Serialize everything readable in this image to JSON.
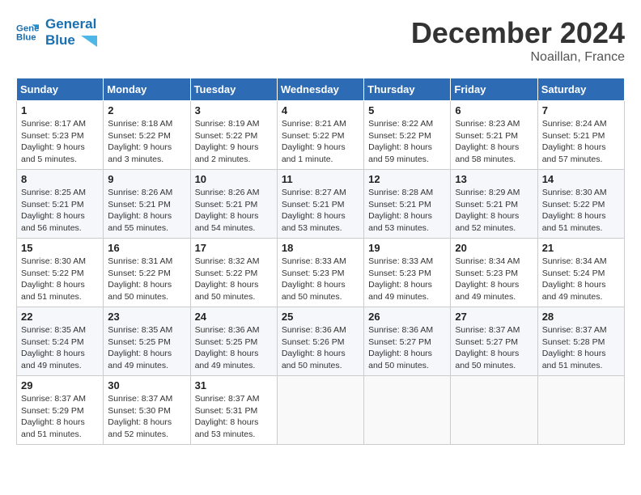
{
  "header": {
    "logo_line1": "General",
    "logo_line2": "Blue",
    "month": "December 2024",
    "location": "Noaillan, France"
  },
  "weekdays": [
    "Sunday",
    "Monday",
    "Tuesday",
    "Wednesday",
    "Thursday",
    "Friday",
    "Saturday"
  ],
  "weeks": [
    [
      {
        "day": "1",
        "info": "Sunrise: 8:17 AM\nSunset: 5:23 PM\nDaylight: 9 hours\nand 5 minutes."
      },
      {
        "day": "2",
        "info": "Sunrise: 8:18 AM\nSunset: 5:22 PM\nDaylight: 9 hours\nand 3 minutes."
      },
      {
        "day": "3",
        "info": "Sunrise: 8:19 AM\nSunset: 5:22 PM\nDaylight: 9 hours\nand 2 minutes."
      },
      {
        "day": "4",
        "info": "Sunrise: 8:21 AM\nSunset: 5:22 PM\nDaylight: 9 hours\nand 1 minute."
      },
      {
        "day": "5",
        "info": "Sunrise: 8:22 AM\nSunset: 5:22 PM\nDaylight: 8 hours\nand 59 minutes."
      },
      {
        "day": "6",
        "info": "Sunrise: 8:23 AM\nSunset: 5:21 PM\nDaylight: 8 hours\nand 58 minutes."
      },
      {
        "day": "7",
        "info": "Sunrise: 8:24 AM\nSunset: 5:21 PM\nDaylight: 8 hours\nand 57 minutes."
      }
    ],
    [
      {
        "day": "8",
        "info": "Sunrise: 8:25 AM\nSunset: 5:21 PM\nDaylight: 8 hours\nand 56 minutes."
      },
      {
        "day": "9",
        "info": "Sunrise: 8:26 AM\nSunset: 5:21 PM\nDaylight: 8 hours\nand 55 minutes."
      },
      {
        "day": "10",
        "info": "Sunrise: 8:26 AM\nSunset: 5:21 PM\nDaylight: 8 hours\nand 54 minutes."
      },
      {
        "day": "11",
        "info": "Sunrise: 8:27 AM\nSunset: 5:21 PM\nDaylight: 8 hours\nand 53 minutes."
      },
      {
        "day": "12",
        "info": "Sunrise: 8:28 AM\nSunset: 5:21 PM\nDaylight: 8 hours\nand 53 minutes."
      },
      {
        "day": "13",
        "info": "Sunrise: 8:29 AM\nSunset: 5:21 PM\nDaylight: 8 hours\nand 52 minutes."
      },
      {
        "day": "14",
        "info": "Sunrise: 8:30 AM\nSunset: 5:22 PM\nDaylight: 8 hours\nand 51 minutes."
      }
    ],
    [
      {
        "day": "15",
        "info": "Sunrise: 8:30 AM\nSunset: 5:22 PM\nDaylight: 8 hours\nand 51 minutes."
      },
      {
        "day": "16",
        "info": "Sunrise: 8:31 AM\nSunset: 5:22 PM\nDaylight: 8 hours\nand 50 minutes."
      },
      {
        "day": "17",
        "info": "Sunrise: 8:32 AM\nSunset: 5:22 PM\nDaylight: 8 hours\nand 50 minutes."
      },
      {
        "day": "18",
        "info": "Sunrise: 8:33 AM\nSunset: 5:23 PM\nDaylight: 8 hours\nand 50 minutes."
      },
      {
        "day": "19",
        "info": "Sunrise: 8:33 AM\nSunset: 5:23 PM\nDaylight: 8 hours\nand 49 minutes."
      },
      {
        "day": "20",
        "info": "Sunrise: 8:34 AM\nSunset: 5:23 PM\nDaylight: 8 hours\nand 49 minutes."
      },
      {
        "day": "21",
        "info": "Sunrise: 8:34 AM\nSunset: 5:24 PM\nDaylight: 8 hours\nand 49 minutes."
      }
    ],
    [
      {
        "day": "22",
        "info": "Sunrise: 8:35 AM\nSunset: 5:24 PM\nDaylight: 8 hours\nand 49 minutes."
      },
      {
        "day": "23",
        "info": "Sunrise: 8:35 AM\nSunset: 5:25 PM\nDaylight: 8 hours\nand 49 minutes."
      },
      {
        "day": "24",
        "info": "Sunrise: 8:36 AM\nSunset: 5:25 PM\nDaylight: 8 hours\nand 49 minutes."
      },
      {
        "day": "25",
        "info": "Sunrise: 8:36 AM\nSunset: 5:26 PM\nDaylight: 8 hours\nand 50 minutes."
      },
      {
        "day": "26",
        "info": "Sunrise: 8:36 AM\nSunset: 5:27 PM\nDaylight: 8 hours\nand 50 minutes."
      },
      {
        "day": "27",
        "info": "Sunrise: 8:37 AM\nSunset: 5:27 PM\nDaylight: 8 hours\nand 50 minutes."
      },
      {
        "day": "28",
        "info": "Sunrise: 8:37 AM\nSunset: 5:28 PM\nDaylight: 8 hours\nand 51 minutes."
      }
    ],
    [
      {
        "day": "29",
        "info": "Sunrise: 8:37 AM\nSunset: 5:29 PM\nDaylight: 8 hours\nand 51 minutes."
      },
      {
        "day": "30",
        "info": "Sunrise: 8:37 AM\nSunset: 5:30 PM\nDaylight: 8 hours\nand 52 minutes."
      },
      {
        "day": "31",
        "info": "Sunrise: 8:37 AM\nSunset: 5:31 PM\nDaylight: 8 hours\nand 53 minutes."
      },
      {
        "day": "",
        "info": ""
      },
      {
        "day": "",
        "info": ""
      },
      {
        "day": "",
        "info": ""
      },
      {
        "day": "",
        "info": ""
      }
    ]
  ]
}
